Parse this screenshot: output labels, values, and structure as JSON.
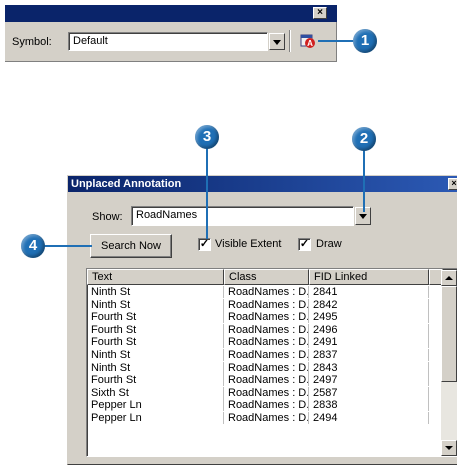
{
  "toolbar": {
    "close_glyph": "×",
    "symbol_label": "Symbol:",
    "symbol_value": "Default",
    "icon": "unplaced-annotation-icon"
  },
  "callouts": [
    "1",
    "2",
    "3",
    "4"
  ],
  "window": {
    "title": "Unplaced Annotation",
    "close_glyph": "×",
    "show_label": "Show:",
    "show_value": "RoadNames",
    "search_button": "Search Now",
    "visible_extent_label": "Visible Extent",
    "visible_extent_checked": true,
    "draw_label": "Draw",
    "draw_checked": true,
    "check_glyph": "✓",
    "columns": [
      "Text",
      "Class",
      "FID Linked"
    ],
    "rows": [
      [
        "Ninth St",
        "RoadNames : D...",
        "2841"
      ],
      [
        "Ninth St",
        "RoadNames : D...",
        "2842"
      ],
      [
        "Fourth St",
        "RoadNames : D...",
        "2495"
      ],
      [
        "Fourth St",
        "RoadNames : D...",
        "2496"
      ],
      [
        "Fourth St",
        "RoadNames : D...",
        "2491"
      ],
      [
        "Ninth St",
        "RoadNames : D...",
        "2837"
      ],
      [
        "Ninth St",
        "RoadNames : D...",
        "2843"
      ],
      [
        "Fourth St",
        "RoadNames : D...",
        "2497"
      ],
      [
        "Sixth St",
        "RoadNames : D...",
        "2587"
      ],
      [
        "Pepper Ln",
        "RoadNames : D...",
        "2838"
      ],
      [
        "Pepper Ln",
        "RoadNames : D...",
        "2494"
      ]
    ]
  },
  "colors": {
    "titlebar": "#0a246a",
    "callout": "#1f6fb5",
    "face": "#d4d0c8"
  }
}
